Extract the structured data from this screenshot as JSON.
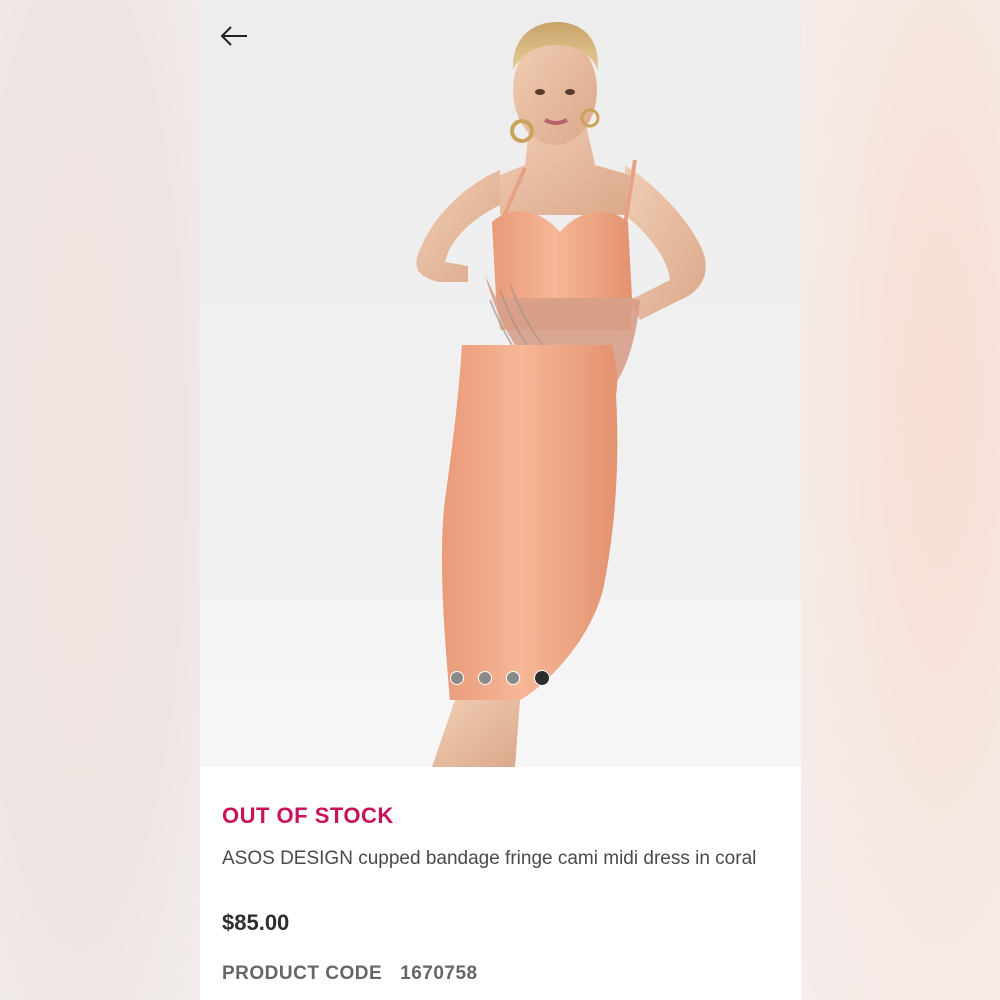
{
  "navigation": {
    "back_icon": "arrow-left-icon"
  },
  "gallery": {
    "image_count": 4,
    "active_index": 3
  },
  "product": {
    "stock_status": "OUT OF STOCK",
    "title": "ASOS DESIGN cupped bandage fringe cami midi dress in coral",
    "price": "$85.00",
    "code_label": "PRODUCT CODE",
    "code_value": "1670758"
  },
  "colors": {
    "stock_status": "#c8135c",
    "dress": "#f0a888",
    "active_dot": "#2d2d2d",
    "inactive_dot": "#8a8a8a"
  }
}
